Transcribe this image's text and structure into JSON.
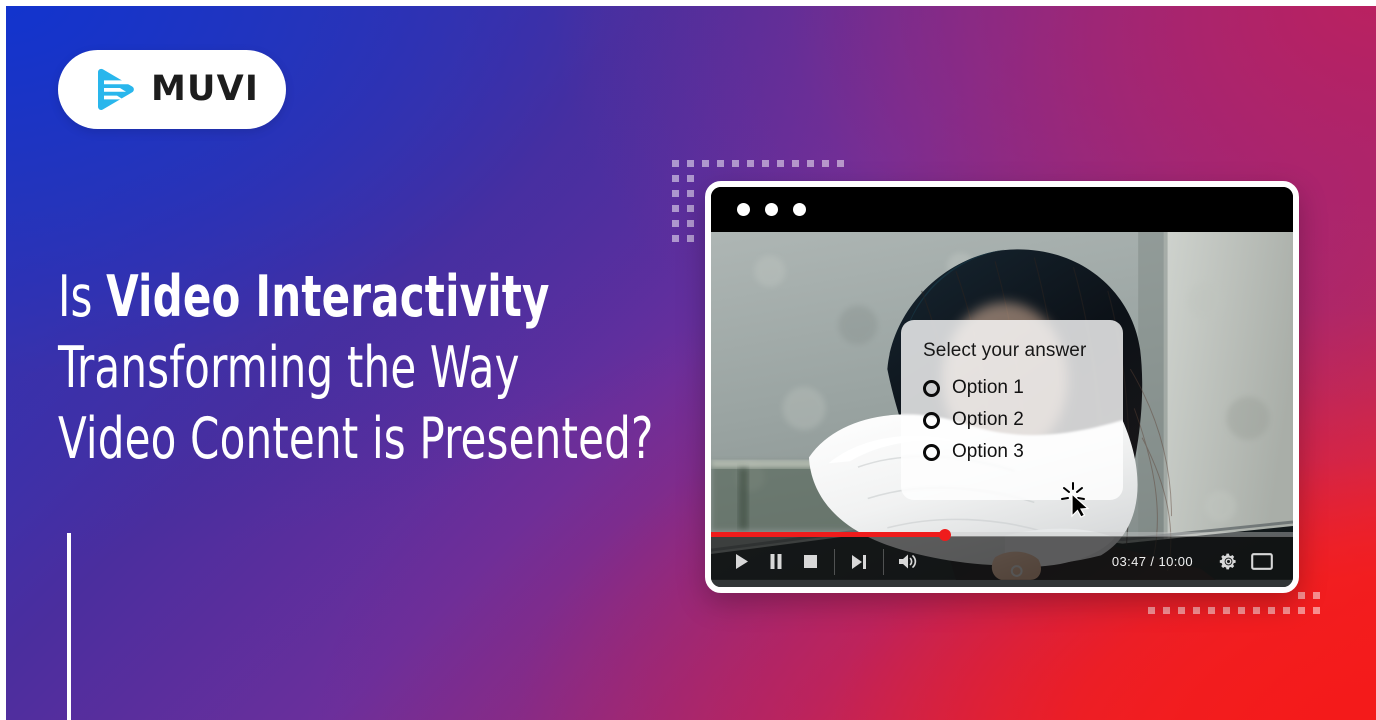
{
  "brand": {
    "name": "MUVI",
    "logo_icon": "muvi-play-wave-icon",
    "logo_mark_color": "#29B6EC",
    "wordmark_color": "#1D1D1D",
    "pill_background": "#FFFFFF"
  },
  "background": {
    "gradient_from": "#1234CE",
    "gradient_mid_purple": "#5B2D9B",
    "gradient_mid_magenta": "#B32460",
    "gradient_to": "#F41A1A",
    "direction": "diagonal top-left to bottom-right"
  },
  "headline": {
    "line1_lead": "Is ",
    "line1_strong": "Video Interactivity",
    "line2": "Transforming the Way",
    "line3": "Video Content is Presented?",
    "color": "#FFFFFF"
  },
  "accent_rule": {
    "color": "#FFFFFF"
  },
  "decor": {
    "dot_color": "#FFFFFF",
    "top_left_label": "dot-grid-top-left",
    "bottom_right_label": "dot-grid-bottom-right"
  },
  "player": {
    "titlebar": {
      "dots": [
        "dot-1",
        "dot-2",
        "dot-3"
      ],
      "background": "#000000"
    },
    "video": {
      "description": "woman with long dark hair leaning forward in white shirt against a gray stone wall",
      "alt_icon": "video-frame"
    },
    "quiz": {
      "title": "Select your answer",
      "options": [
        {
          "label": "Option 1",
          "selected": false
        },
        {
          "label": "Option 2",
          "selected": false
        },
        {
          "label": "Option 3",
          "selected": false
        }
      ]
    },
    "cursor_icon": "click-cursor-icon",
    "controls": {
      "play_icon": "play-icon",
      "pause_icon": "pause-icon",
      "stop_icon": "stop-icon",
      "next_icon": "skip-next-icon",
      "volume_icon": "volume-icon",
      "settings_icon": "gear-icon",
      "fullscreen_icon": "fullscreen-icon",
      "time_current": "03:47",
      "time_total": "10:00",
      "time_readout": "03:47 / 10:00",
      "progress_percent": 40,
      "progress_color": "#EF1C1C",
      "bar_background": "rgba(18,18,18,0.66)"
    }
  }
}
